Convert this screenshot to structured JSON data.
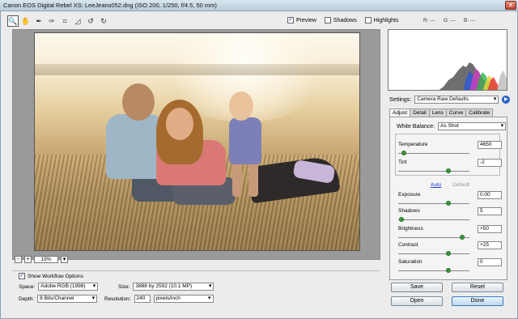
{
  "window": {
    "title": "Canon EOS Digital Rebel XS:  LeeJeans052.dng  (ISO 200, 1/250, f/4.5, 50 mm)",
    "close_glyph": "✕"
  },
  "toolbar": {
    "tools": [
      {
        "icon": "zoom-icon",
        "glyph": "🔍"
      },
      {
        "icon": "hand-icon",
        "glyph": "✋"
      },
      {
        "icon": "eyedropper-icon",
        "glyph": "✒"
      },
      {
        "icon": "color-sampler-icon",
        "glyph": "✑"
      },
      {
        "icon": "crop-icon",
        "glyph": "⌗"
      },
      {
        "icon": "straighten-icon",
        "glyph": "◿"
      },
      {
        "icon": "rotate-left-icon",
        "glyph": "↺"
      },
      {
        "icon": "rotate-right-icon",
        "glyph": "↻"
      }
    ]
  },
  "view_options": {
    "preview": {
      "label": "Preview",
      "checked": true
    },
    "shadows": {
      "label": "Shadows",
      "checked": false
    },
    "highlights": {
      "label": "Highlights",
      "checked": false
    }
  },
  "rgb_readout": {
    "r": "R:  ---",
    "g": "G:  ---",
    "b": "B:  ---"
  },
  "zoom": {
    "minus": "-",
    "plus": "+",
    "value": "19%",
    "dropdown": "▾"
  },
  "workflow": {
    "show_label": "Show Workflow Options",
    "checked": true,
    "space_label": "Space:",
    "space_value": "Adobe RGB (1998)",
    "depth_label": "Depth:",
    "depth_value": "8 Bits/Channel",
    "size_label": "Size:",
    "size_value": "3888 by 2592  (10.1 MP)",
    "resolution_label": "Resolution:",
    "resolution_value": "240",
    "resolution_unit": "pixels/inch"
  },
  "settings": {
    "label": "Settings:",
    "value": "Camera Raw Defaults",
    "go_glyph": "▶"
  },
  "tabs": [
    "Adjust",
    "Detail",
    "Lens",
    "Curve",
    "Calibrate"
  ],
  "active_tab": "Adjust",
  "adjust": {
    "white_balance_label": "White Balance:",
    "white_balance_value": "As Shot",
    "temperature": {
      "label": "Temperature",
      "value": "4650",
      "level": 0.08
    },
    "tint": {
      "label": "Tint",
      "value": "-2",
      "level": 0.7
    },
    "auto_label": "Auto",
    "default_label": "Default",
    "exposure": {
      "label": "Exposure",
      "value": "0.00",
      "level": 0.7
    },
    "shadows": {
      "label": "Shadows",
      "value": "5",
      "level": 0.05
    },
    "brightness": {
      "label": "Brightness",
      "value": "+50",
      "level": 0.9
    },
    "contrast": {
      "label": "Contrast",
      "value": "+25",
      "level": 0.7
    },
    "saturation": {
      "label": "Saturation",
      "value": "0",
      "level": 0.7
    }
  },
  "buttons": {
    "save": "Save",
    "reset": "Reset",
    "open": "Open",
    "done": "Done"
  },
  "colors": {
    "accent": "#2a63c4",
    "slider_knob": "#3a9a3a"
  }
}
